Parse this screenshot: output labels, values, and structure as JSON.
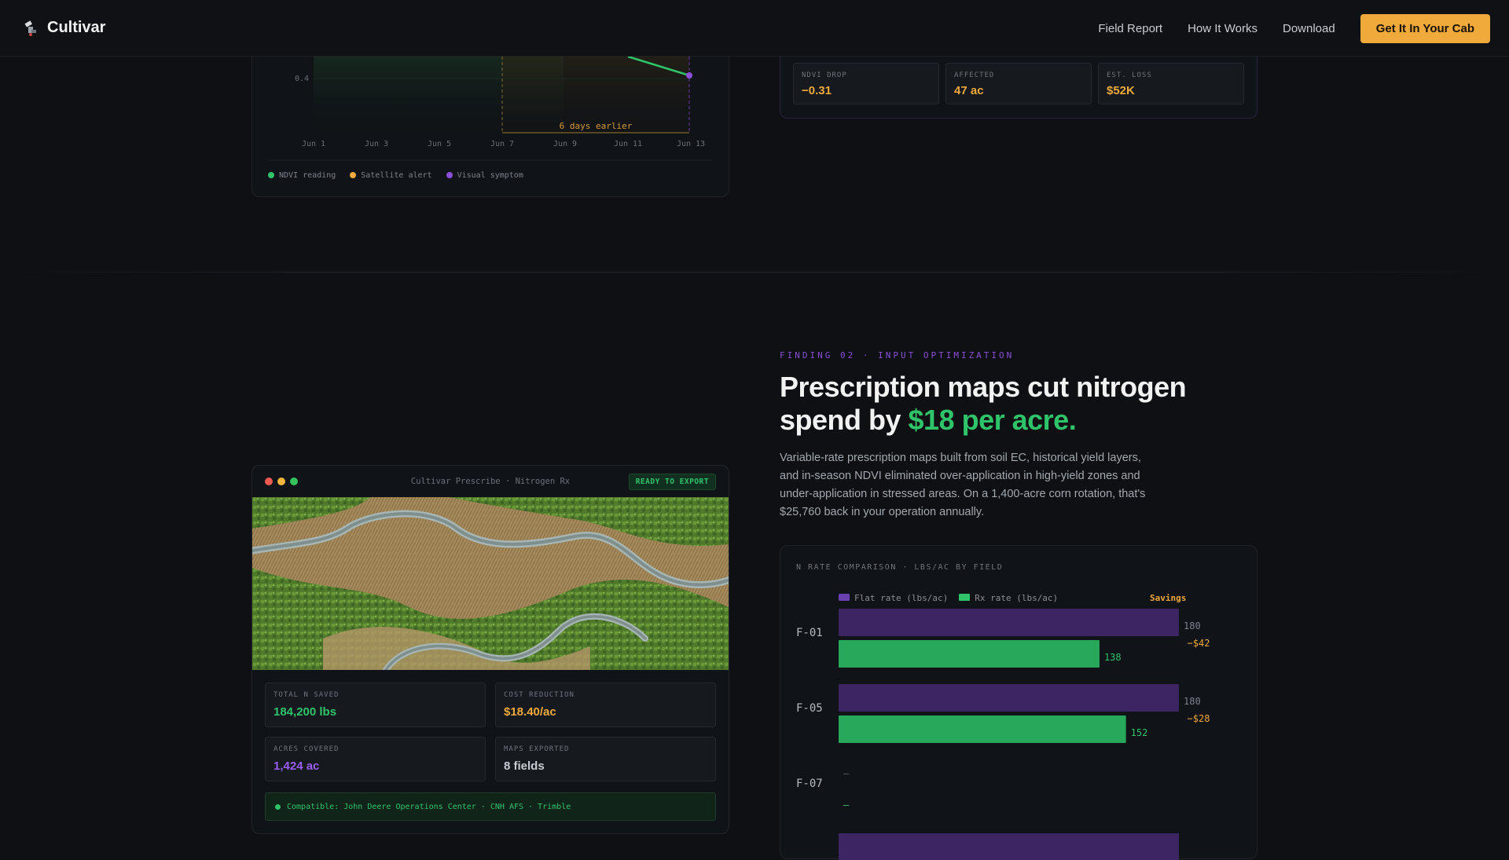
{
  "colors": {
    "background": "#0e1013",
    "green": "#2fc36a",
    "purple": "#8b4fd8",
    "orange": "#f0a93b",
    "purple_bar": "#3d2463",
    "green_bar": "#27a85b"
  },
  "nav": {
    "brand": "Cultivar",
    "brand_icon": "satellite-icon",
    "links": [
      "Field Report",
      "How It Works",
      "Download"
    ],
    "cta": "Get It In Your Cab"
  },
  "ndvi_chart": {
    "y_tick": "0.4",
    "annotation": "6 days earlier",
    "x_ticks": [
      "Jun 1",
      "Jun 3",
      "Jun 5",
      "Jun 7",
      "Jun 9",
      "Jun 11",
      "Jun 13"
    ],
    "legend": [
      {
        "label": "NDVI reading",
        "color": "#2fc36a"
      },
      {
        "label": "Satellite alert",
        "color": "#f0a93b"
      },
      {
        "label": "Visual symptom",
        "color": "#8b4fd8"
      }
    ]
  },
  "finding01_stats": [
    {
      "label": "NDVI DROP",
      "value": "−0.31",
      "color": "#f0a93b"
    },
    {
      "label": "AFFECTED",
      "value": "47 ac",
      "color": "#f0a93b"
    },
    {
      "label": "EST. LOSS",
      "value": "$52K",
      "color": "#f0a93b"
    }
  ],
  "finding02": {
    "eyebrow": "FINDING 02 · INPUT OPTIMIZATION",
    "headline_a": "Prescription maps cut nitrogen",
    "headline_b": "spend by ",
    "headline_accent": "$18 per acre.",
    "body": "Variable-rate prescription maps built from soil EC, historical yield layers, and in-season NDVI eliminated over-application in high-yield zones and under-application in stressed areas. On a 1,400-acre corn rotation, that's $25,760 back in your operation annually."
  },
  "prescribe_window": {
    "title": "Cultivar Prescribe · Nitrogen Rx",
    "badge": "READY TO EXPORT",
    "stats": [
      {
        "label": "TOTAL N SAVED",
        "value": "184,200 lbs",
        "color": "#2fc36a"
      },
      {
        "label": "COST REDUCTION",
        "value": "$18.40/ac",
        "color": "#f0a93b"
      },
      {
        "label": "ACRES COVERED",
        "value": "1,424 ac",
        "color": "#9b5cf0"
      },
      {
        "label": "MAPS EXPORTED",
        "value": "8 fields",
        "color": "#c9ccd2"
      }
    ],
    "compat": "Compatible: John Deere Operations Center · CNH AFS · Trimble"
  },
  "chart_data": {
    "type": "bar",
    "title": "N RATE COMPARISON · LBS/AC BY FIELD",
    "legend": [
      "Flat rate (lbs/ac)",
      "Rx rate (lbs/ac)"
    ],
    "savings_label": "Savings",
    "categories": [
      "F-01",
      "F-05",
      "F-07"
    ],
    "series": [
      {
        "name": "Flat rate (lbs/ac)",
        "values": [
          180,
          180,
          null
        ]
      },
      {
        "name": "Rx rate (lbs/ac)",
        "values": [
          138,
          152,
          null
        ]
      }
    ],
    "savings": [
      "−$42",
      "−$28",
      null
    ],
    "missing_label": "—",
    "xlim": [
      0,
      180
    ]
  }
}
